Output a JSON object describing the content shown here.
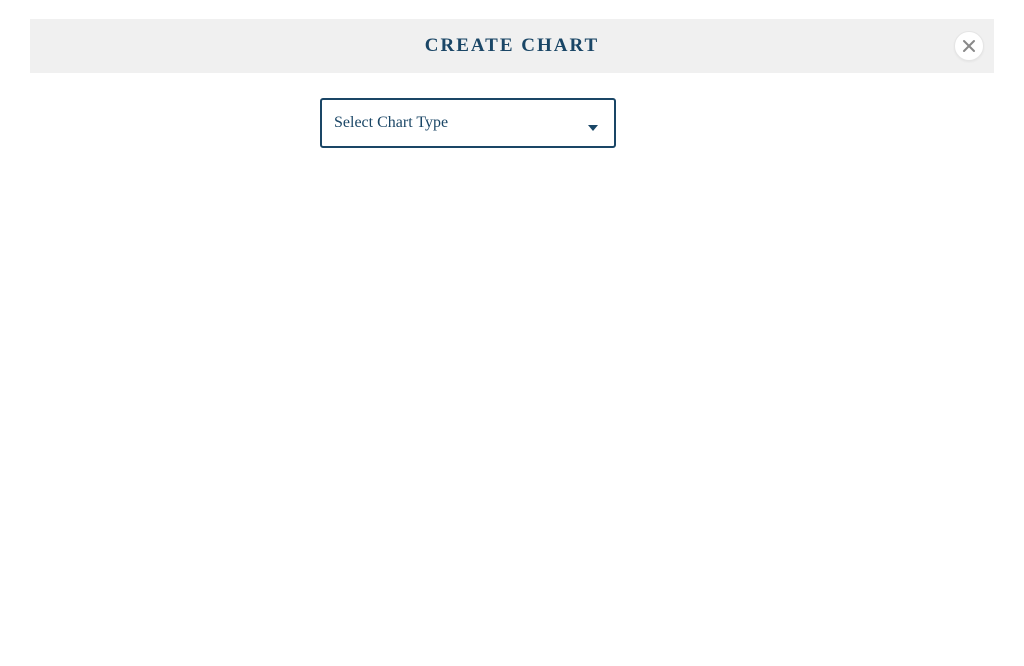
{
  "modal": {
    "title": "CREATE CHART",
    "select": {
      "placeholder": "Select Chart Type"
    }
  }
}
